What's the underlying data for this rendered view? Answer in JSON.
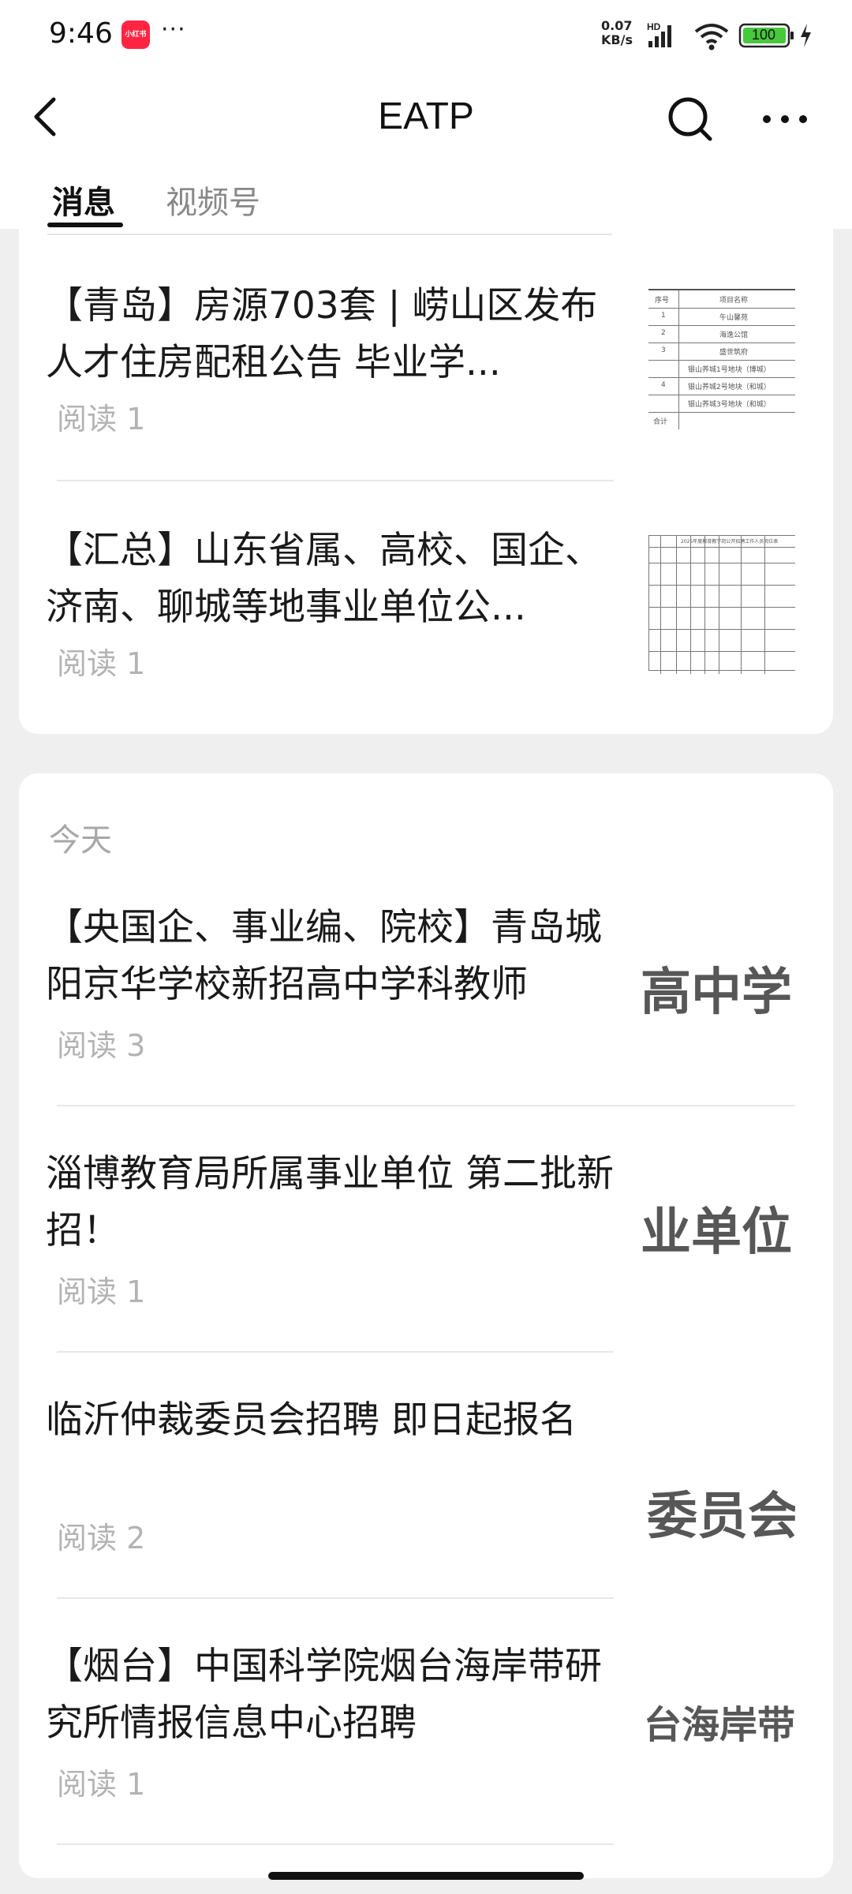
{
  "status_bar": {
    "time": "9:46",
    "app_badge": "小红书",
    "dots": "···",
    "net_speed_value": "0.07",
    "net_speed_unit": "KB/s",
    "hd_label": "HD",
    "battery": "100"
  },
  "header": {
    "title": "EATP"
  },
  "tabs": [
    {
      "label": "消息"
    },
    {
      "label": "视频号"
    }
  ],
  "section": {
    "today_label": "今天"
  },
  "articles_top": [
    {
      "title": "【青岛】房源703套 | 崂山区发布人才住房配租公告 毕业学...",
      "read": "阅读 1",
      "thumb_cells": [
        "序号",
        "项目名称",
        "1",
        "午山馨苑",
        "2",
        "海逸公馆",
        "3",
        "盛世筑府",
        "4",
        "银山荞城1号地块（博城）",
        "银山荞城2号地块（和城）",
        "银山荞城3号地块（和城）",
        "合计"
      ]
    },
    {
      "title": "【汇总】山东省属、高校、国企、济南、聊城等地事业单位公...",
      "read": "阅读 1",
      "thumb_cells": [
        "2025年度教育教学岗公开招聘工作人员岗位表"
      ]
    }
  ],
  "articles_today": [
    {
      "title": "【央国企、事业编、院校】青岛城阳京华学校新招高中学科教师",
      "read": "阅读 3",
      "thumb_text": "高中学"
    },
    {
      "title": "淄博教育局所属事业单位 第二批新招！",
      "read": "阅读 1",
      "thumb_text": "业单位"
    },
    {
      "title": "临沂仲裁委员会招聘 即日起报名",
      "read": "阅读 2",
      "thumb_text": "委员会"
    },
    {
      "title": "【烟台】中国科学院烟台海岸带研究所情报信息中心招聘",
      "read": "阅读 1",
      "thumb_text": "台海岸带"
    }
  ]
}
